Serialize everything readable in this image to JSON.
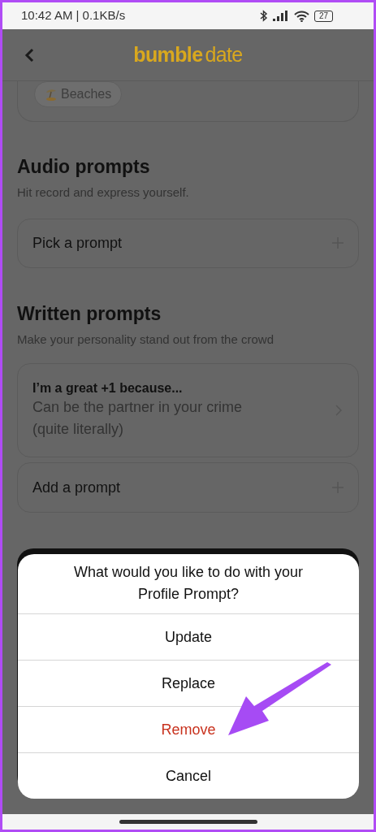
{
  "status_bar": {
    "time": "10:42 AM | 0.1KB/s",
    "battery": "27"
  },
  "header": {
    "logo_bold": "bumble",
    "logo_light": "date"
  },
  "interests": {
    "chips": [
      "Beaches"
    ]
  },
  "audio_prompts": {
    "title": "Audio prompts",
    "subtitle": "Hit record and express yourself.",
    "button": "Pick a prompt"
  },
  "written_prompts": {
    "title": "Written prompts",
    "subtitle": "Make your personality stand out from the crowd",
    "prompts": [
      {
        "question": "I’m a great +1 because...",
        "answer": "Can be the partner in your crime (quite literally)"
      }
    ],
    "add_button": "Add a prompt"
  },
  "action_sheet": {
    "title": "What would you like to do with your Profile Prompt?",
    "actions": [
      {
        "label": "Update",
        "kind": "default"
      },
      {
        "label": "Replace",
        "kind": "default"
      },
      {
        "label": "Remove",
        "kind": "destructive"
      },
      {
        "label": "Cancel",
        "kind": "default"
      }
    ]
  }
}
